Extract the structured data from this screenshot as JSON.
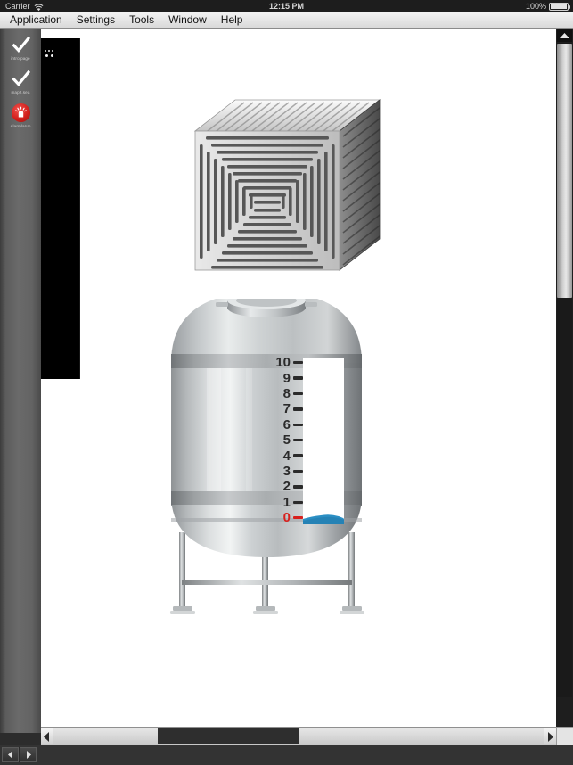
{
  "status_bar": {
    "carrier": "Carrier",
    "wifi_icon": "wifi-icon",
    "time": "12:15 PM",
    "battery_percent": "100%",
    "battery_icon": "battery-icon"
  },
  "menu_bar": {
    "items": [
      {
        "label": "Application",
        "name": "menu-application"
      },
      {
        "label": "Settings",
        "name": "menu-settings"
      },
      {
        "label": "Tools",
        "name": "menu-tools"
      },
      {
        "label": "Window",
        "name": "menu-window"
      },
      {
        "label": "Help",
        "name": "menu-help"
      }
    ]
  },
  "sidebar": {
    "items": [
      {
        "label": "intro page",
        "icon": "checkmark-icon"
      },
      {
        "label": "map2.sea",
        "icon": "checkmark-icon"
      },
      {
        "label": "Alarmlarım",
        "icon": "alarm-siren-icon"
      }
    ]
  },
  "canvas": {
    "objects": [
      {
        "name": "crate-box-graphic",
        "type": "3d-crate"
      },
      {
        "name": "storage-tank-graphic",
        "type": "level-tank"
      }
    ]
  },
  "tank": {
    "scale_values": [
      "10",
      "9",
      "8",
      "7",
      "6",
      "5",
      "4",
      "3",
      "2",
      "1",
      "0"
    ],
    "zero_label": "0",
    "level_value": "0",
    "level_color": "#d8201d",
    "liquid_color": "#2b8fc4",
    "body_color": "#b9bcbe"
  },
  "scrollbars": {
    "vertical": {
      "up_arrow": "scroll-up-arrow-icon",
      "thumb_position": "top"
    },
    "horizontal": {
      "left_arrow": "scroll-left-arrow-icon",
      "right_arrow": "scroll-right-arrow-icon"
    },
    "mini": {
      "left_arrow": "mini-left-arrow-icon",
      "right_arrow": "mini-right-arrow-icon"
    }
  },
  "colors": {
    "accent_red": "#d8201d",
    "liquid_blue": "#2b8fc4",
    "canvas_bg": "#ffffff",
    "chrome_dark": "#2c2c2c"
  }
}
